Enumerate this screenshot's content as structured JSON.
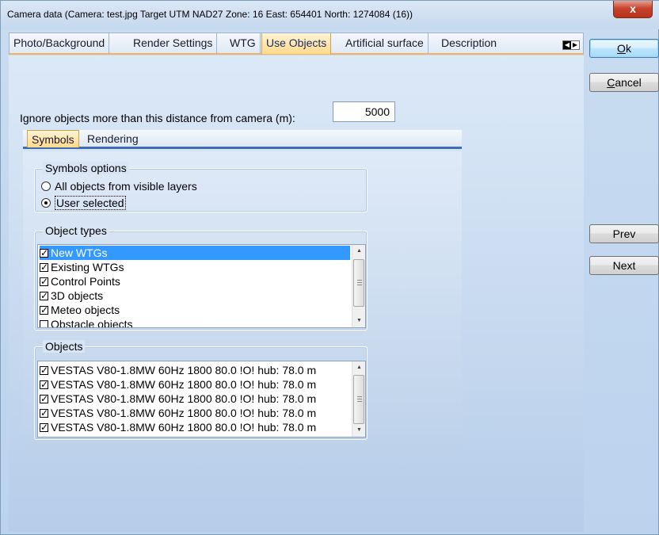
{
  "window": {
    "title": "Camera data  (Camera: test.jpg  Target UTM NAD27 Zone: 16  East: 654401  North: 1274084 (16))",
    "close_glyph": "x"
  },
  "tabs": [
    {
      "label": "Photo/Background"
    },
    {
      "label": "Render Settings"
    },
    {
      "label": "WTG"
    },
    {
      "label": "Use Objects",
      "active": true
    },
    {
      "label": "Artificial surface"
    },
    {
      "label": "Description"
    }
  ],
  "distance": {
    "label": "Ignore objects more than this distance from camera (m):",
    "value": "5000"
  },
  "inner_tabs": [
    {
      "label": "Symbols",
      "active": true
    },
    {
      "label": "Rendering"
    }
  ],
  "symbols_options": {
    "title": "Symbols options",
    "options": [
      {
        "label": "All objects from visible layers",
        "selected": false
      },
      {
        "label": "User selected",
        "selected": true
      }
    ]
  },
  "object_types": {
    "title": "Object types",
    "items": [
      {
        "label": "New WTGs",
        "checked": true,
        "selected": true
      },
      {
        "label": "Existing WTGs",
        "checked": true
      },
      {
        "label": "Control Points",
        "checked": true
      },
      {
        "label": "3D objects",
        "checked": true
      },
      {
        "label": "Meteo objects",
        "checked": true
      },
      {
        "label": "Obstacle objects",
        "checked": false
      }
    ]
  },
  "objects": {
    "title": "Objects",
    "items": [
      {
        "label": "VESTAS V80-1.8MW  60Hz 1800 80.0 !O! hub: 78.0 m",
        "checked": true
      },
      {
        "label": "VESTAS V80-1.8MW  60Hz 1800 80.0 !O! hub: 78.0 m",
        "checked": true
      },
      {
        "label": "VESTAS V80-1.8MW  60Hz 1800 80.0 !O! hub: 78.0 m",
        "checked": true
      },
      {
        "label": "VESTAS V80-1.8MW  60Hz 1800 80.0 !O! hub: 78.0 m",
        "checked": true
      },
      {
        "label": "VESTAS V80-1.8MW  60Hz 1800 80.0 !O! hub: 78.0 m",
        "checked": true
      }
    ]
  },
  "buttons": {
    "ok_rest": "k",
    "ok_mnemonic": "O",
    "cancel_mnemonic": "C",
    "cancel_rest": "ancel",
    "prev": "Prev",
    "next": "Next"
  }
}
